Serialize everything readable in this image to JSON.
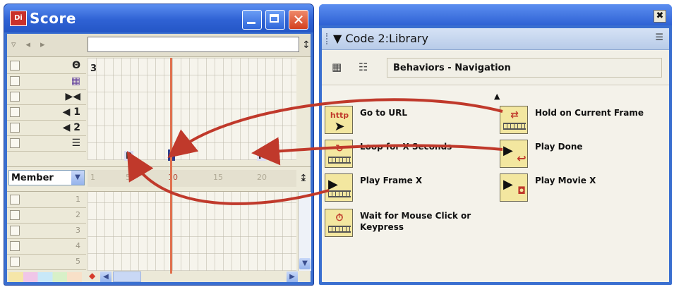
{
  "score": {
    "title": "Score",
    "app_icon": "Di",
    "channels": [
      {
        "icon": "tempo-icon",
        "glyph": "Θ"
      },
      {
        "icon": "palette-icon",
        "glyph": "▦"
      },
      {
        "icon": "transition-icon",
        "glyph": "▶◀"
      },
      {
        "icon": "sound1-icon",
        "glyph": "◀ 1"
      },
      {
        "icon": "sound2-icon",
        "glyph": "◀ 2"
      },
      {
        "icon": "script-icon",
        "glyph": "☰"
      }
    ],
    "script_frame_number": "3",
    "sprite_markers": [
      "P",
      "3",
      "P"
    ],
    "member_label": "Member",
    "ruler_ticks": [
      "1",
      "5",
      "10",
      "15",
      "20"
    ],
    "sprite_channels": [
      "1",
      "2",
      "3",
      "4",
      "5"
    ]
  },
  "library": {
    "title": "Code 2:Library",
    "dropdown": "Behaviors - Navigation",
    "close_glyph": "✖",
    "behaviors_left": [
      {
        "label": "Go to URL",
        "icon": "http-icon"
      },
      {
        "label": "Loop for X Seconds",
        "icon": "loop-icon"
      },
      {
        "label": "Play Frame X",
        "icon": "play-frame-icon"
      },
      {
        "label": "Wait for Mouse Click or Keypress",
        "icon": "wait-icon"
      }
    ],
    "behaviors_right": [
      {
        "label": "Hold on Current Frame",
        "icon": "hold-icon"
      },
      {
        "label": "Play Done",
        "icon": "play-done-icon"
      },
      {
        "label": "Play Movie X",
        "icon": "play-movie-icon"
      }
    ]
  },
  "colors": {
    "accent_arrow": "#c0392b",
    "title_bar": "#2f62d4",
    "playhead": "#e0714f"
  }
}
